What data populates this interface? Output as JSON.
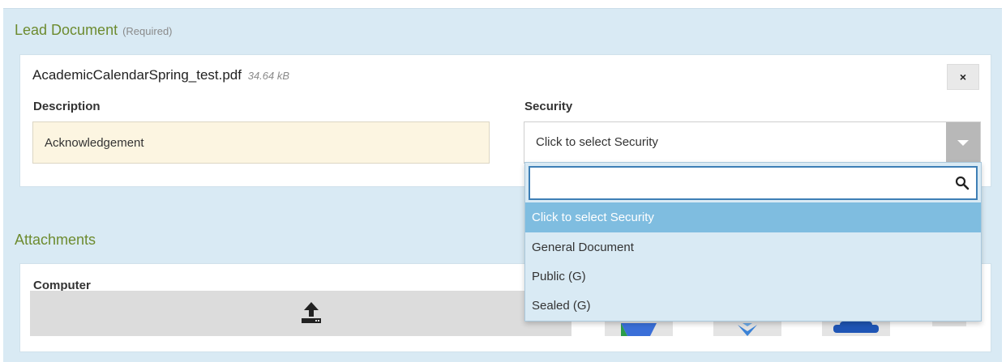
{
  "lead_document": {
    "title": "Lead Document",
    "required_note": "(Required)",
    "file_name": "AcademicCalendarSpring_test.pdf",
    "file_size": "34.64 kB",
    "close_label": "×",
    "description_label": "Description",
    "description_value": "Acknowledgement",
    "security_label": "Security",
    "security_value": "Click to select Security"
  },
  "security_dropdown": {
    "search_value": "",
    "options": [
      "Click to select Security",
      "General Document",
      "Public (G)",
      "Sealed (G)"
    ],
    "selected_index": 0
  },
  "attachments": {
    "title": "Attachments",
    "computer_label": "Computer"
  },
  "colors": {
    "panel_bg": "#d9eaf4",
    "section_title": "#6d8b2f",
    "highlight": "#7fbde0",
    "focus_border": "#3e7fb6"
  }
}
